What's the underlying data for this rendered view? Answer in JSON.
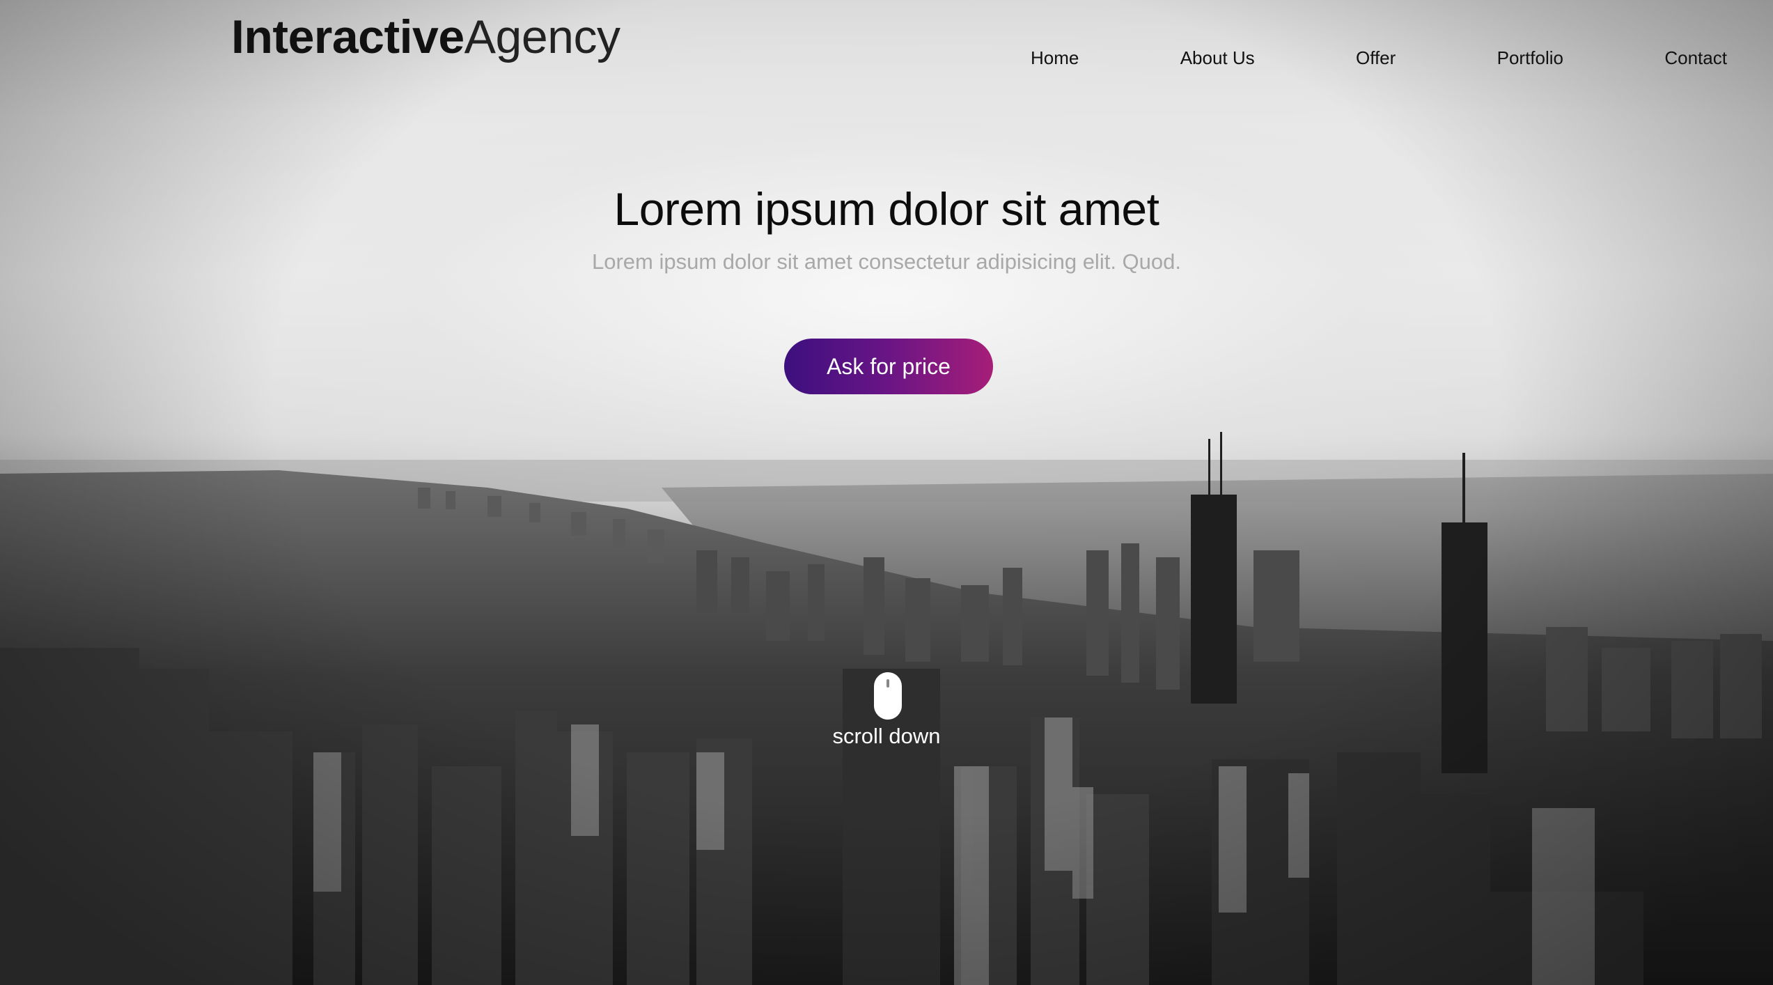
{
  "brand": {
    "name_bold": "Interactive",
    "name_light": "Agency"
  },
  "nav": {
    "items": [
      {
        "label": "Home"
      },
      {
        "label": "About Us"
      },
      {
        "label": "Offer"
      },
      {
        "label": "Portfolio"
      },
      {
        "label": "Contact"
      }
    ]
  },
  "hero": {
    "title": "Lorem ipsum dolor sit amet",
    "subtitle": "Lorem ipsum dolor sit amet consectetur adipisicing elit. Quod.",
    "cta_label": "Ask for price",
    "scroll_label": "scroll down",
    "scroll_icon": "mouse-icon",
    "background_image": "grayscale aerial city skyline",
    "colors": {
      "cta_gradient_start": "#3d0f7e",
      "cta_gradient_end": "#a61e78",
      "title": "#0c0c0c",
      "subtitle": "#a8a8a8"
    }
  }
}
